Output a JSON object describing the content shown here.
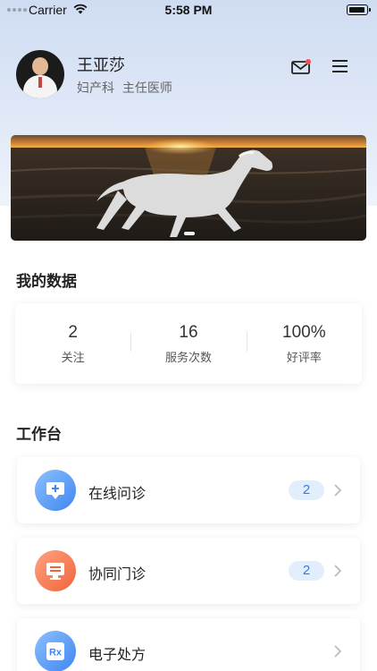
{
  "status_bar": {
    "carrier": "Carrier",
    "time": "5:58 PM"
  },
  "profile": {
    "name": "王亚莎",
    "department": "妇产科",
    "position": "主任医师"
  },
  "stats": {
    "title": "我的数据",
    "items": [
      {
        "value": "2",
        "label": "关注"
      },
      {
        "value": "16",
        "label": "服务次数"
      },
      {
        "value": "100%",
        "label": "好评率"
      }
    ]
  },
  "workbench": {
    "title": "工作台",
    "items": [
      {
        "label": "在线问诊",
        "badge": "2",
        "icon": "online-consult-icon",
        "color_from": "#7fb7ff",
        "color_to": "#3f86f0"
      },
      {
        "label": "协同门诊",
        "badge": "2",
        "icon": "clinic-icon",
        "color_from": "#ff9a76",
        "color_to": "#f0643c"
      },
      {
        "label": "电子处方",
        "badge": "",
        "icon": "prescription-icon",
        "color_from": "#7fb7ff",
        "color_to": "#3f86f0",
        "icon_text": "Rx"
      }
    ]
  },
  "colors": {
    "accent": "#3b78e7",
    "badge_bg": "#e3eefc",
    "mail_dot": "#ff4d4f"
  }
}
